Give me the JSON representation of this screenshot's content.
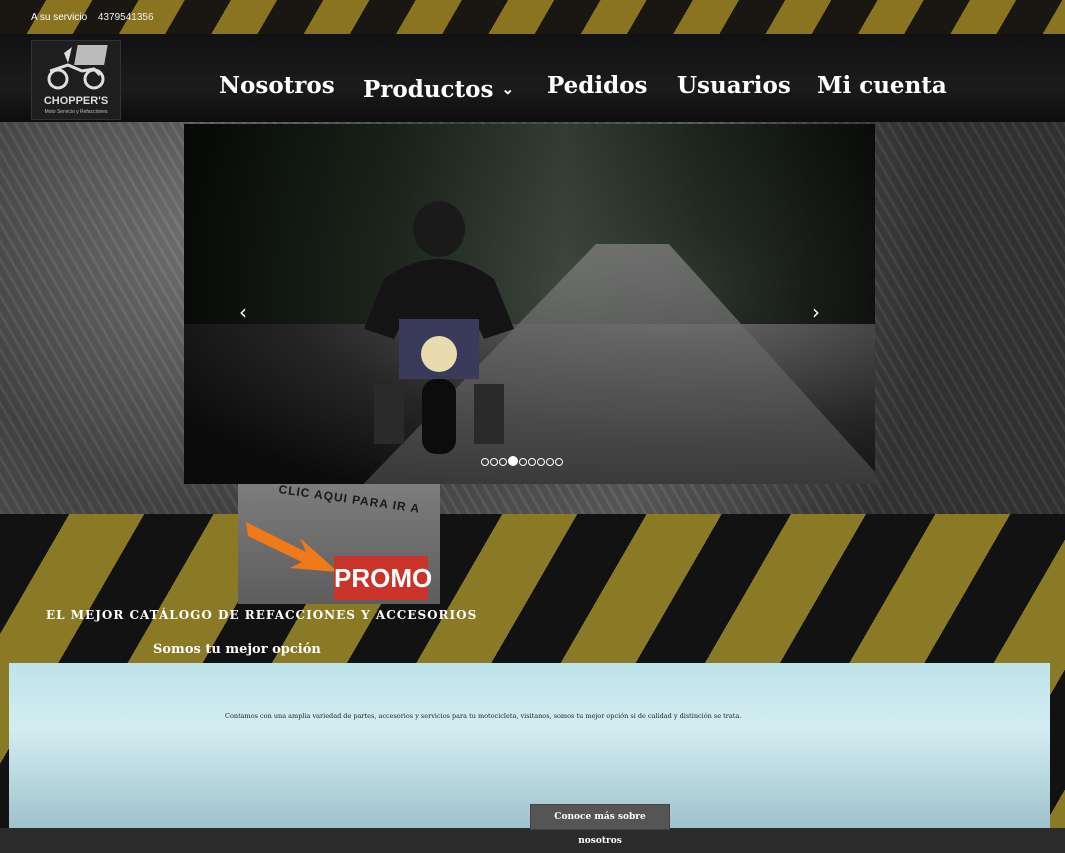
{
  "topbar": {
    "service_label": "A su servicio",
    "phone": "4379541356"
  },
  "logo": {
    "brand": "CHOPPER'S",
    "tagline": "Moto Servicio y Refacciones"
  },
  "nav": {
    "items": [
      {
        "label": "Nosotros"
      },
      {
        "label": "Productos",
        "dropdown": true
      },
      {
        "label": "Pedidos"
      },
      {
        "label": "Usuarios"
      },
      {
        "label": "Mi cuenta"
      }
    ]
  },
  "carousel": {
    "slide_count": 9,
    "active_index": 3
  },
  "promo": {
    "text": "CLIC AQUI PARA IR A",
    "badge": "PROMO"
  },
  "catalog": {
    "heading": "EL MEJOR CATÁLOGO DE REFACCIONES Y ACCESORIOS",
    "subheading": "Somos tu mejor opción"
  },
  "about": {
    "description": "Contamos con una amplia variedad de partes, accesorios y servicios para tu motocicleta, visitanos, somos tu mejor opción si de calidad y distinción se trata.",
    "button_label": "Conoce más sobre nosotros"
  },
  "colors": {
    "stripe_yellow": "#8b7a25",
    "stripe_black": "#121212",
    "promo_red": "#c9332a"
  },
  "icons": {
    "prev": "chevron-left-icon",
    "next": "chevron-right-icon",
    "dropdown": "chevron-down-icon"
  }
}
